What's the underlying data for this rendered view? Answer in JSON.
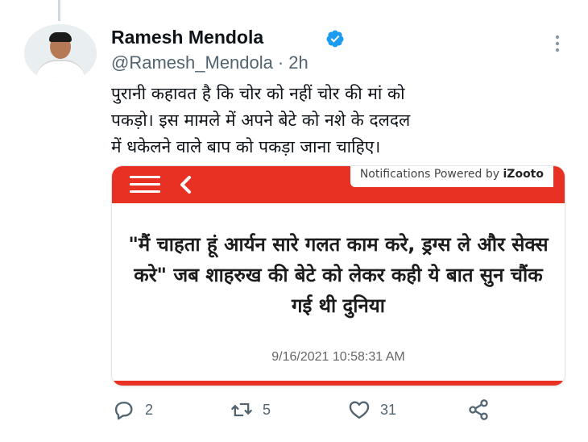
{
  "tweet": {
    "name": "Ramesh Mendola",
    "handle": "@Ramesh_Mendola",
    "separator": "·",
    "time": "2h",
    "text": "पुरानी कहावत है कि चोर को नहीं चोर की मां को\nपकड़ो। इस मामले में अपने बेटे को नशे के दलदल\nमें धकेलने वाले बाप को पकड़ा जाना चाहिए।"
  },
  "card": {
    "notification_prefix": "Notifications Powered by ",
    "notification_brand": "iZooto",
    "headline": "\"मैं चाहता हूं आर्यन सारे गलत काम करे, ड्रग्स ले और सेक्स करे\" जब शाहरुख की बेटे को लेकर कही ये बात सुन चौंक गई थी दुनिया",
    "timestamp": "9/16/2021 10:58:31 AM"
  },
  "actions": {
    "replies": "2",
    "retweets": "5",
    "likes": "31"
  },
  "icons": {
    "verified": "verified-badge-icon",
    "more": "more-dots-icon",
    "reply": "reply-icon",
    "retweet": "retweet-icon",
    "like": "heart-icon",
    "share": "share-icon"
  },
  "colors": {
    "verified": "#1d9bf0",
    "muted": "#536471",
    "card_bar": "#e83122"
  }
}
